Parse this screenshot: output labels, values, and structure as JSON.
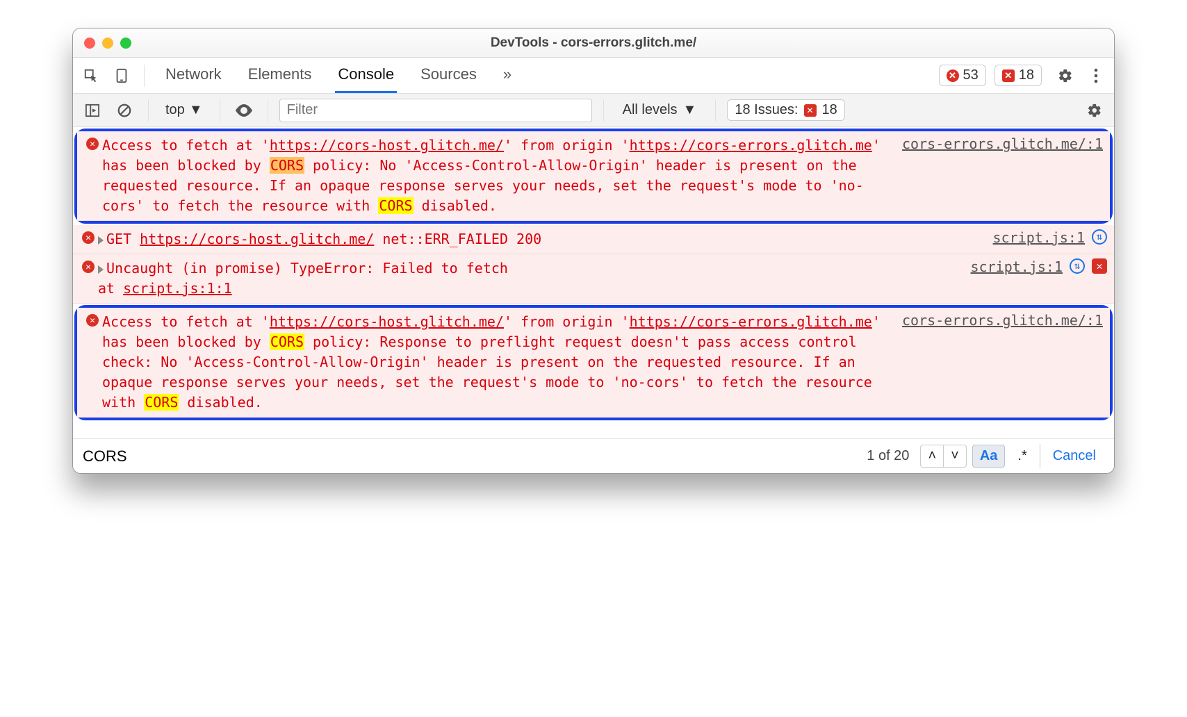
{
  "window": {
    "title": "DevTools - cors-errors.glitch.me/"
  },
  "tabs": {
    "items": [
      "Network",
      "Elements",
      "Console",
      "Sources"
    ],
    "active_index": 2,
    "overflow_glyph": "»"
  },
  "counters": {
    "errors": "53",
    "issues": "18"
  },
  "console_toolbar": {
    "context": "top",
    "filter_placeholder": "Filter",
    "levels_label": "All levels",
    "issues_label": "18 Issues:",
    "issues_count": "18"
  },
  "messages": [
    {
      "kind": "cors1",
      "highlighted": true,
      "source": "cors-errors.glitch.me/:1",
      "parts": {
        "p1": "Access to fetch at '",
        "url1": "https://cors-host.glitch.me/",
        "p2": "' from origin '",
        "url2": "https://cors-errors.glitch.me",
        "p3": "' has been blocked by ",
        "cors1": "CORS",
        "p4": " policy: No 'Access-Control-Allow-Origin' header is present on the requested resource. If an opaque response serves your needs, set the request's mode to 'no-cors' to fetch the resource with ",
        "cors2": "CORS",
        "p5": " disabled."
      }
    },
    {
      "kind": "netfail",
      "source": "script.js:1",
      "parts": {
        "p1": "GET ",
        "url": "https://cors-host.glitch.me/",
        "p2": " net::ERR_FAILED 200"
      }
    },
    {
      "kind": "uncaught",
      "source": "script.js:1",
      "parts": {
        "line1": "Uncaught (in promise) TypeError: Failed to fetch",
        "line2a": "    at ",
        "line2b": "script.js:1:1"
      }
    },
    {
      "kind": "cors2",
      "highlighted": true,
      "source": "cors-errors.glitch.me/:1",
      "parts": {
        "p1": "Access to fetch at '",
        "url1": "https://cors-host.glitch.me/",
        "p2": "' from origin '",
        "url2": "https://cors-errors.glitch.me",
        "p3": "' has been blocked by ",
        "cors1": "CORS",
        "p4": " policy: Response to preflight request doesn't pass access control check: No 'Access-Control-Allow-Origin' header is present on the requested resource. If an opaque response serves your needs, set the request's mode to 'no-cors' to fetch the resource with ",
        "cors2": "CORS",
        "p5": " disabled."
      }
    }
  ],
  "findbar": {
    "query": "CORS",
    "count": "1 of 20",
    "match_case_label": "Aa",
    "regex_label": ".*",
    "cancel_label": "Cancel"
  }
}
